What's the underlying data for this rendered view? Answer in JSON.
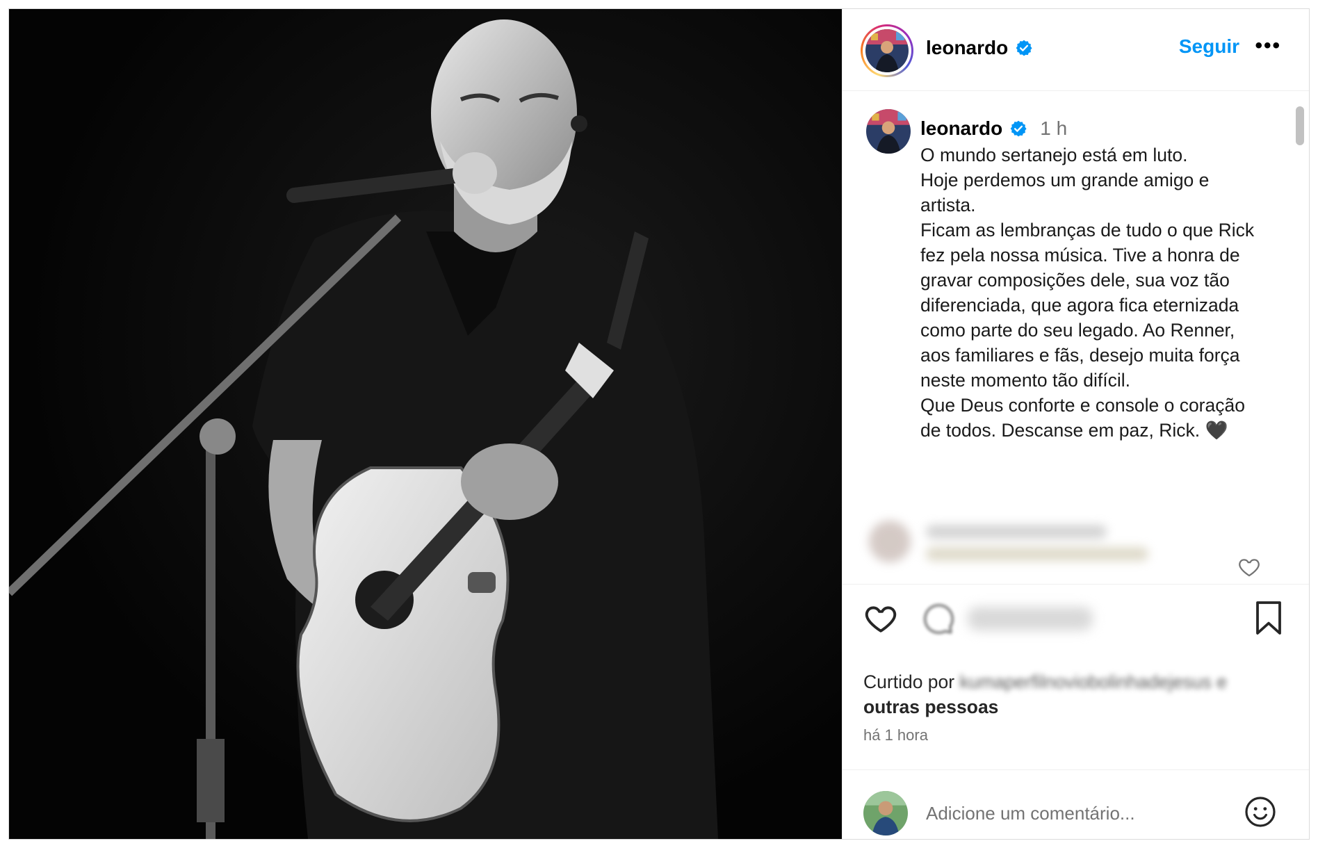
{
  "header": {
    "username": "leonardo",
    "follow_label": "Seguir",
    "more_label": "•••"
  },
  "caption": {
    "username": "leonardo",
    "time": "1 h",
    "text": "O mundo sertanejo está em luto.\nHoje perdemos um grande amigo e artista.\nFicam as lembranças de tudo o que Rick fez pela nossa música. Tive a honra de gravar composições dele, sua voz tão diferenciada, que agora fica eternizada como parte do seu legado. Ao Renner, aos familiares e fãs, desejo muita força neste momento tão difícil.\nQue Deus conforte e console o coração de todos. Descanse em paz, Rick. 🖤"
  },
  "likes": {
    "prefix": "Curtido por",
    "blurred_user": "kumaperfilnoviobolinhadejesus",
    "connector": "e",
    "others": "outras pessoas"
  },
  "post_time": "há 1 hora",
  "comment_input": {
    "placeholder": "Adicione um comentário..."
  },
  "icons": {
    "verified": "verified-badge-icon",
    "like": "heart-icon",
    "comment": "comment-bubble-icon",
    "save": "bookmark-icon",
    "emoji": "smiley-icon",
    "more": "more-dots-icon"
  },
  "colors": {
    "accent": "#0095f6",
    "verified": "#0095f6",
    "border": "#dbdbdb",
    "muted_text": "#737373"
  }
}
